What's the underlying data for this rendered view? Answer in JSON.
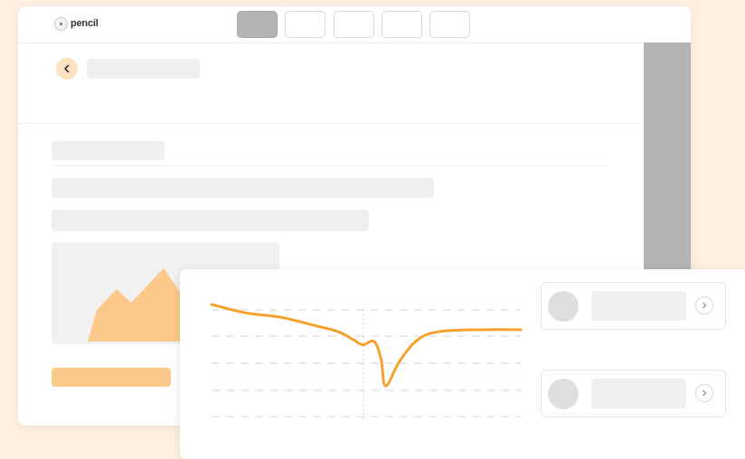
{
  "app": {
    "logo_text": "pencil"
  },
  "topbar": {
    "tabs": [
      {
        "name": "tab-1",
        "active": true
      },
      {
        "name": "tab-2",
        "active": false
      },
      {
        "name": "tab-3",
        "active": false
      },
      {
        "name": "tab-4",
        "active": false
      },
      {
        "name": "tab-5",
        "active": false
      }
    ]
  },
  "icons": {
    "logo": "pencil-logo-icon",
    "back": "chevron-left-icon",
    "list_item": "chevron-right-icon",
    "image": "mountain-image-icon"
  },
  "colors": {
    "background": "#fdf1e3",
    "accent": "#f5a12f",
    "accent_light": "#fdc98a",
    "back_button": "#fde2c2",
    "skeleton": "#efefef",
    "scrollbar": "#b4b4b4"
  },
  "list": {
    "items": [
      {
        "id": 1
      },
      {
        "id": 2
      }
    ]
  },
  "chart_data": {
    "type": "line",
    "title": "",
    "xlabel": "",
    "ylabel": "",
    "grid": true,
    "series": [
      {
        "values": [
          {
            "x": 0,
            "y": 10
          },
          {
            "x": 15,
            "y": 9
          },
          {
            "x": 30,
            "y": 8.5
          },
          {
            "x": 45,
            "y": 7.5
          },
          {
            "x": 55,
            "y": 6.8
          },
          {
            "x": 62,
            "y": 5.8
          },
          {
            "x": 66,
            "y": 5.2
          },
          {
            "x": 71,
            "y": 5.6
          },
          {
            "x": 74,
            "y": 3.5
          },
          {
            "x": 76,
            "y": 0.3
          },
          {
            "x": 82,
            "y": 3.2
          },
          {
            "x": 90,
            "y": 5.8
          },
          {
            "x": 100,
            "y": 6.8
          },
          {
            "x": 120,
            "y": 7.0
          },
          {
            "x": 135,
            "y": 7.0
          }
        ]
      }
    ]
  }
}
